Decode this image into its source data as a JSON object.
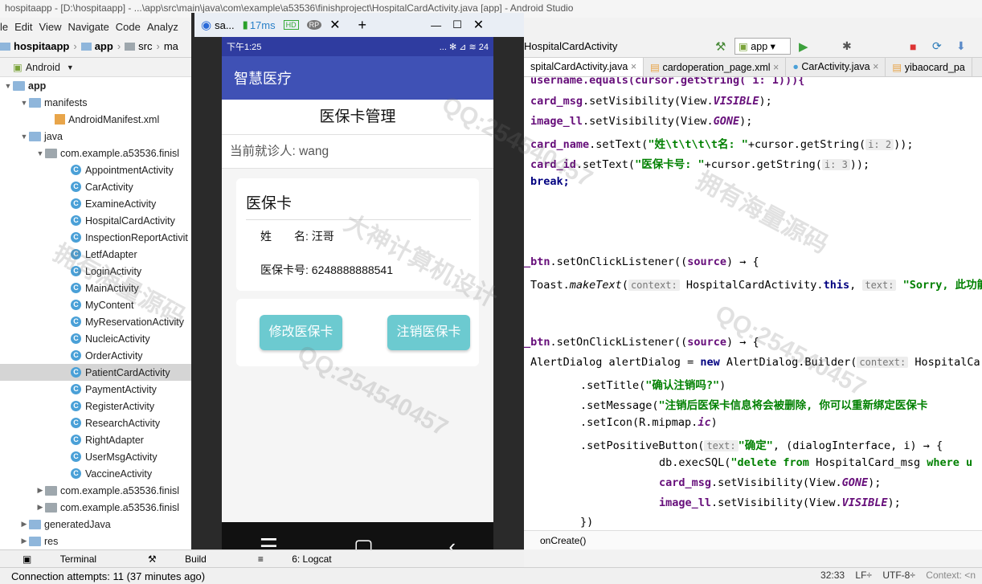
{
  "window": {
    "title": "hospitaapp - [D:\\hospitaapp] - ...\\app\\src\\main\\java\\com\\example\\a53536\\finishproject\\HospitalCardActivity.java [app] - Android Studio"
  },
  "menu": [
    "le",
    "Edit",
    "View",
    "Navigate",
    "Code",
    "Analyz"
  ],
  "nav": {
    "crumbs": [
      "hospitaapp",
      "app",
      "src",
      "ma"
    ],
    "right_crumb": "HospitalCardActivity",
    "run_config": "app"
  },
  "project": {
    "view_mode": "Android",
    "app": "app",
    "manifests": "manifests",
    "manifest_file": "AndroidManifest.xml",
    "java": "java",
    "package1": "com.example.a53536.finisl",
    "classes": [
      "AppointmentActivity",
      "CarActivity",
      "ExamineActivity",
      "HospitalCardActivity",
      "InspectionReportActivit",
      "LetfAdapter",
      "LoginActivity",
      "MainActivity",
      "MyContent",
      "MyReservationActivity",
      "NucleicActivity",
      "OrderActivity",
      "PatientCardActivity",
      "PaymentActivity",
      "RegisterActivity",
      "ResearchActivity",
      "RightAdapter",
      "UserMsgActivity",
      "VaccineActivity"
    ],
    "selected_index": 12,
    "package2": "com.example.a53536.finisl",
    "package3": "com.example.a53536.finisl",
    "generated": "generatedJava",
    "res": "res"
  },
  "tabs": [
    "spitalCardActivity.java",
    "cardoperation_page.xml",
    "CarActivity.java",
    "yibaocard_pa"
  ],
  "emulator": {
    "tab_label": "sa...",
    "latency": "17ms",
    "status_time": "下午1:25",
    "status_right": "... ✻ ⊿ ≋ 24",
    "app_title": "智慧医疗",
    "page_title": "医保卡管理",
    "patient_label": "当前就诊人: wang",
    "card_title": "医保卡",
    "card_name": "姓　　名: 汪哥",
    "card_id": "医保卡号: 6248888888541",
    "btn_modify": "修改医保卡",
    "btn_cancel": "注销医保卡"
  },
  "code": {
    "l1": "username.equals(cursor.getString( i: 1))){",
    "l2_field": "card_msg",
    "l2_rest": ".setVisibility(View.",
    "l2_const": "VISIBLE",
    "l2_end": ");",
    "l3_field": "image_ll",
    "l3_rest": ".setVisibility(View.",
    "l3_const": "GONE",
    "l3_end": ");",
    "l4_field": "card_name",
    "l4_rest": ".setText(",
    "l4_str": "\"姓\\t\\t\\t\\t名: \"",
    "l4_rest2": "+cursor.getString(",
    "l4_hint": "i: 2",
    "l4_end": "));",
    "l5_field": "card_id",
    "l5_rest": ".setText(",
    "l5_str": "\"医保卡号: \"",
    "l5_rest2": "+cursor.getString(",
    "l5_hint": "i: 3",
    "l5_end": "));",
    "l6": "break;",
    "l7_field": "_btn",
    "l7_rest": ".setOnClickListener((",
    "l7_param": "source",
    "l7_end": ") → {",
    "l8_a": "Toast.",
    "l8_method": "makeText",
    "l8_b": "(",
    "l8_hint1": "context:",
    "l8_c": " HospitalCardActivity.",
    "l8_kw": "this",
    "l8_d": ",",
    "l8_hint2": "text:",
    "l8_str": "\"Sorry, 此功能",
    "l9_field": "_btn",
    "l9_rest": ".setOnClickListener((",
    "l9_param": "source",
    "l9_end": ") → {",
    "l10_a": "AlertDialog alertDialog = ",
    "l10_kw": "new",
    "l10_b": " AlertDialog.Builder(",
    "l10_hint": "context:",
    "l10_c": " HospitalCar",
    "l11_a": ".setTitle(",
    "l11_str": "\"确认注销吗?\"",
    "l11_b": ")",
    "l12_a": ".setMessage(",
    "l12_str": "\"注销后医保卡信息将会被删除, 你可以重新绑定医保卡",
    "l13_a": ".setIcon(R.mipmap.",
    "l13_ital": "ic",
    "l13_b": ")",
    "l14_a": ".setPositiveButton(",
    "l14_hint": "text:",
    "l14_str": "\"确定\"",
    "l14_b": ", (dialogInterface, i) → {",
    "l15_a": "db.execSQL(",
    "l15_str": "\"delete from",
    "l15_b": " HospitalCard_msg ",
    "l15_str2": "where u",
    "l16_field": "card_msg",
    "l16_rest": ".setVisibility(View.",
    "l16_const": "GONE",
    "l16_end": ");",
    "l17_field": "image_ll",
    "l17_rest": ".setVisibility(View.",
    "l17_const": "VISIBLE",
    "l17_end": ");",
    "l18": "})"
  },
  "editor_footer": "onCreate()",
  "toolwindows": [
    "Terminal",
    "Build",
    "6: Logcat"
  ],
  "status": {
    "message": "Connection attempts: 11 (37 minutes ago)",
    "position": "32:33",
    "line_sep": "LF÷",
    "encoding": "UTF-8÷",
    "context": "Context: <n"
  },
  "watermarks": [
    "QQ:254540457",
    "大神计算机设计",
    "拥有海量源码"
  ]
}
